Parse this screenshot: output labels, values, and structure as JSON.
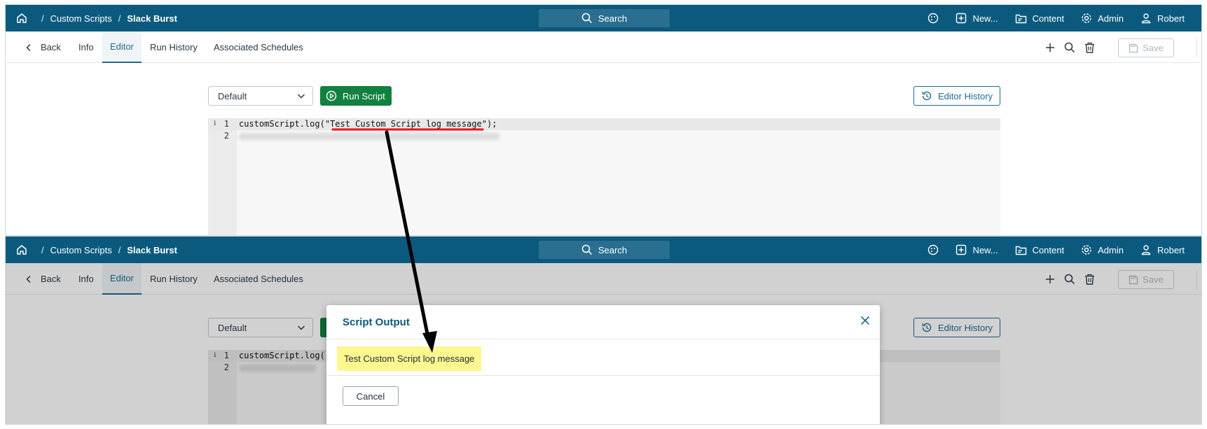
{
  "breadcrumb": {
    "item1": "Custom Scripts",
    "item2": "Slack Burst",
    "separator": "/"
  },
  "topbar": {
    "search_label": "Search",
    "new_label": "New...",
    "content_label": "Content",
    "admin_label": "Admin",
    "user_label": "Robert"
  },
  "subnav": {
    "back_label": "Back",
    "tabs": [
      "Info",
      "Editor",
      "Run History",
      "Associated Schedules"
    ],
    "active_tab": "Editor",
    "save_label": "Save"
  },
  "toolbar": {
    "select_value": "Default",
    "run_label": "Run Script",
    "history_label": "Editor History"
  },
  "editor": {
    "line_numbers": [
      "1",
      "2"
    ],
    "line1": "customScript.log(\"Test Custom Script log message\");",
    "line1_truncated": "customScript.log("
  },
  "modal": {
    "title": "Script Output",
    "output": "Test Custom Script log message",
    "cancel_label": "Cancel"
  },
  "colors": {
    "topbar": "#0b5a7e",
    "run_button": "#12813f",
    "accent": "#1e6a91",
    "highlight": "#fdf78f",
    "annotation_underline": "#e8141c",
    "annotation_arrow": "#000000"
  },
  "icons": [
    "home-icon",
    "search-icon",
    "palette-icon",
    "plus-square-icon",
    "folder-icon",
    "gear-icon",
    "user-icon",
    "chevron-left-icon",
    "plus-icon",
    "magnifier-icon",
    "trash-icon",
    "save-icon",
    "chevron-down-icon",
    "play-circle-icon",
    "history-icon",
    "close-icon"
  ]
}
